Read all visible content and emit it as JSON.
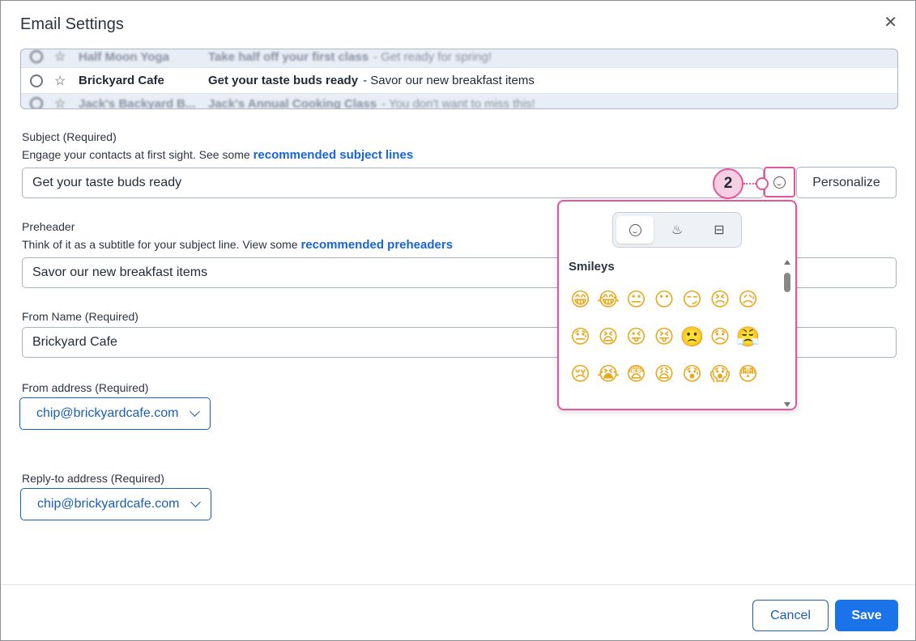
{
  "dialog": {
    "title": "Email Settings",
    "close_glyph": "✕"
  },
  "preview": {
    "rows": [
      {
        "sender": "Half Moon Yoga",
        "subject": "Take half off your first class",
        "preheader": " - Get ready for spring!"
      },
      {
        "sender": "Brickyard Cafe",
        "subject": "Get your taste buds ready",
        "preheader": " - Savor our new breakfast items"
      },
      {
        "sender": "Jack's Backyard B...",
        "subject": "Jack's Annual Cooking Class",
        "preheader": " - You don't want to miss this!"
      }
    ]
  },
  "subject": {
    "label": "Subject",
    "required": "(Required)",
    "hint": "Engage your contacts at first sight. See some ",
    "hint_link": "recommended subject lines",
    "value": "Get your taste buds ready",
    "personalize_label": "Personalize"
  },
  "callout": {
    "number": "2"
  },
  "preheader": {
    "label": "Preheader",
    "hint": "Think of it as a subtitle for your subject line. View some ",
    "hint_link": "recommended preheaders",
    "value": "Savor our new breakfast items"
  },
  "from_name": {
    "label": "From Name",
    "required": "(Required)",
    "value": "Brickyard Cafe"
  },
  "from_address": {
    "label": "From address",
    "required": "(Required)",
    "value": "chip@brickyardcafe.com"
  },
  "reply_to": {
    "label": "Reply-to address",
    "required": "(Required)",
    "value": "chip@brickyardcafe.com"
  },
  "emoji_picker": {
    "tabs": [
      {
        "icon": "smiley-icon",
        "glyph": "☺"
      },
      {
        "icon": "food-bowl-icon",
        "glyph": "♨"
      },
      {
        "icon": "briefcase-icon",
        "glyph": "⊟"
      }
    ],
    "category": "Smileys",
    "emojis": [
      "😁",
      "😂",
      "😐",
      "😶",
      "😏",
      "😣",
      "😥",
      "😓",
      "😫",
      "😜",
      "😝",
      "🙁",
      "😞",
      "😤",
      "😢",
      "😭",
      "😨",
      "😩",
      "😰",
      "😱",
      "😳"
    ]
  },
  "footer": {
    "cancel_label": "Cancel",
    "save_label": "Save"
  },
  "colors": {
    "accent": "#1a73e8",
    "highlight": "#e0579b"
  }
}
